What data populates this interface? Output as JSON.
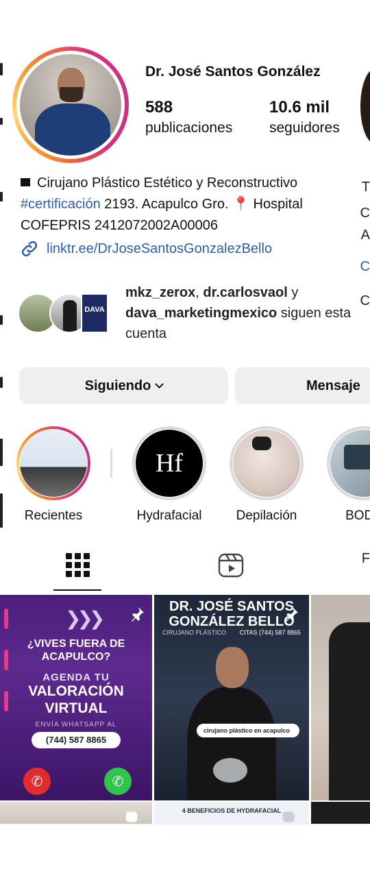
{
  "profile": {
    "name": "Dr. José Santos González",
    "posts_count": "588",
    "posts_label": "publicaciones",
    "followers_count": "10.6 mil",
    "followers_label": "seguidores"
  },
  "bio": {
    "line1": "Cirujano Plástico Estético y Reconstructivo",
    "line2_hashtag": "#certificación",
    "line2_rest": " 2193. Acapulco Gro. 📍 Hospital",
    "line3": "COFEPRIS 2412072002A00006",
    "link": "linktr.ee/DrJoseSantosGonzalezBello"
  },
  "followed_by": {
    "user1": "mkz_zerox",
    "sep1": ", ",
    "user2": "dr.carlosvaol",
    "and": " y",
    "user3": "dava_marketingmexico",
    "suffix": " siguen esta",
    "line3": "cuenta",
    "dava_badge": "DAVA"
  },
  "buttons": {
    "following": "Siguiendo",
    "message": "Mensaje"
  },
  "highlights": [
    {
      "label": "Recientes"
    },
    {
      "label": "Hydrafacial",
      "mark": "Hf"
    },
    {
      "label": "Depilación"
    },
    {
      "label": "BODY"
    }
  ],
  "tabs": {
    "grid": "grid-icon",
    "reels": "reels-icon"
  },
  "posts": {
    "post1": {
      "heading": "¿VIVES FUERA DE ACAPULCO?",
      "sub": "AGENDA TU",
      "main": "VALORACIÓN VIRTUAL",
      "note": "ENVÍA WHATSAPP AL",
      "phone": "(744) 587 8865"
    },
    "post2": {
      "title": "DR. JOSÉ SANTOS GONZÁLEZ BELLO",
      "role": "CIRUJANO PLÁSTICO",
      "citas": "CITAS (744) 587 8865",
      "search": "cirujano plástico en acapulco"
    },
    "post5": {
      "title": "4 BENEFICIOS DE HYDRAFACIAL"
    }
  },
  "colors": {
    "link": "#2c5db0",
    "button_bg": "#efeff1",
    "story_gradient": [
      "#f58529",
      "#feda77",
      "#dd2a7b",
      "#c13584"
    ]
  }
}
